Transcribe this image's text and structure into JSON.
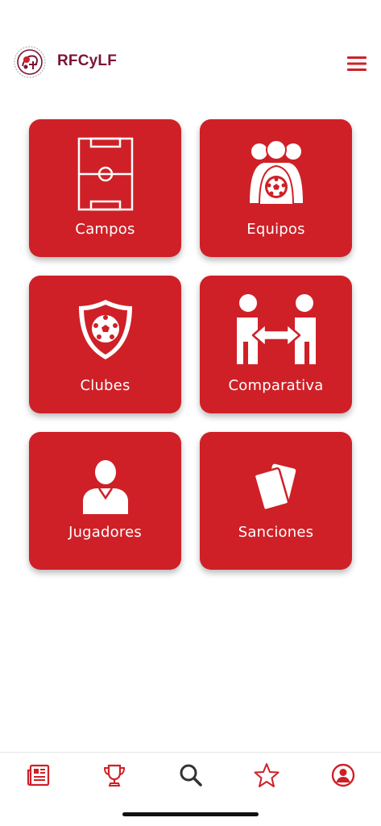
{
  "header": {
    "brand": "RFCyLF",
    "logo_icon": "rfcylf-crest-icon",
    "menu_icon": "hamburger-menu-icon"
  },
  "tiles": [
    {
      "label": "Campos",
      "icon": "football-field-icon"
    },
    {
      "label": "Equipos",
      "icon": "team-ball-icon"
    },
    {
      "label": "Clubes",
      "icon": "shield-ball-icon"
    },
    {
      "label": "Comparativa",
      "icon": "compare-people-arrow-icon"
    },
    {
      "label": "Jugadores",
      "icon": "player-person-icon"
    },
    {
      "label": "Sanciones",
      "icon": "cards-icon"
    }
  ],
  "bottom_nav": [
    {
      "icon": "newspaper-icon"
    },
    {
      "icon": "trophy-icon"
    },
    {
      "icon": "search-icon"
    },
    {
      "icon": "star-icon"
    },
    {
      "icon": "user-profile-icon"
    }
  ],
  "colors": {
    "accent": "#cf2027",
    "brand_text": "#7b1438",
    "nav_icon_red": "#cf2027",
    "nav_icon_dark": "#333333"
  }
}
